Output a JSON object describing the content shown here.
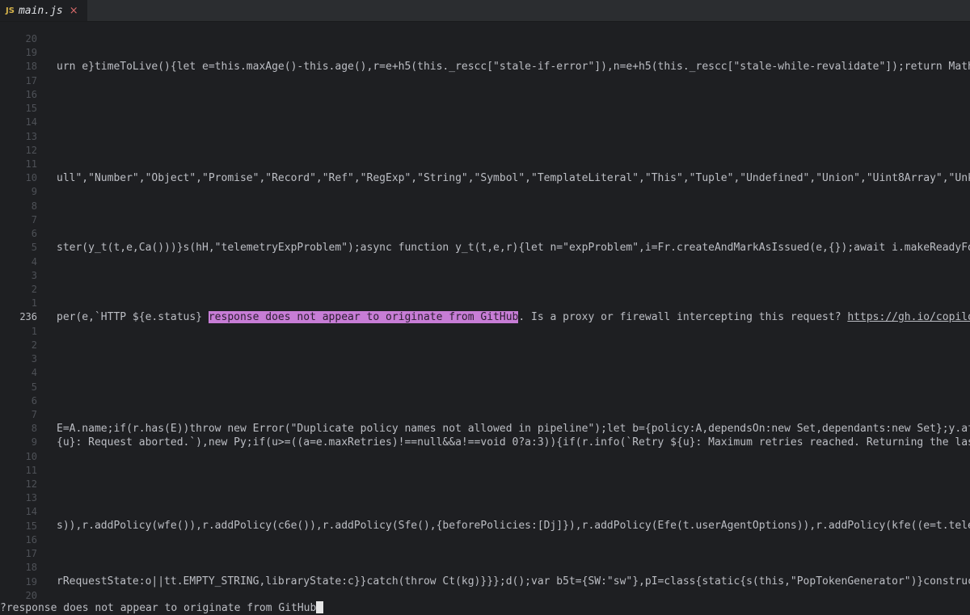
{
  "tab": {
    "icon": "JS",
    "filename": "main.js",
    "close": "×"
  },
  "gutter": [
    "20",
    "19",
    "18",
    "17",
    "16",
    "15",
    "14",
    "13",
    "12",
    "11",
    "10",
    "9",
    "8",
    "7",
    "6",
    "5",
    "4",
    "3",
    "2",
    "1",
    "236",
    "1",
    "2",
    "3",
    "4",
    "5",
    "6",
    "7",
    "8",
    "9",
    "10",
    "11",
    "12",
    "13",
    "14",
    "15",
    "16",
    "17",
    "18",
    "19",
    "20"
  ],
  "current_line_index": 20,
  "lines": {
    "l18": "urn e}timeToLive(){let e=this.maxAge()-this.age(),r=e+h5(this._rescc[\"stale-if-error\"]),n=e+h5(this._rescc[\"stale-while-revalidate\"]);return Math.",
    "l10": "ull\",\"Number\",\"Object\",\"Promise\",\"Record\",\"Ref\",\"RegExp\",\"String\",\"Symbol\",\"TemplateLiteral\",\"This\",\"Tuple\",\"Undefined\",\"Union\",\"Uint8Array\",\"Unkn",
    "l5": "ster(y_t(t,e,Ca()))}s(hH,\"telemetryExpProblem\");async function y_t(t,e,r){let n=\"expProblem\",i=Fr.createAndMarkAsIssued(e,{});await i.makeReadyFor",
    "l236_pre": "per(e,`HTTP ${e.status} ",
    "l236_match": "response does not appear to originate from GitHub",
    "l236_post": ". Is a proxy or firewall intercepting this request? ",
    "l236_link": "https://gh.io/copilot",
    "l8": "E=A.name;if(r.has(E))throw new Error(\"Duplicate policy names not allowed in pipeline\");let b={policy:A,dependsOn:new Set,dependants:new Set};y.aft",
    "l9": "{u}: Request aborted.`),new Py;if(u>=((a=e.maxRetries)!==null&&a!==void 0?a:3)){if(r.info(`Retry ${u}: Maximum retries reached. Returning the last",
    "l15": "s)),r.addPolicy(wfe()),r.addPolicy(c6e()),r.addPolicy(Sfe(),{beforePolicies:[Dj]}),r.addPolicy(Efe(t.userAgentOptions)),r.addPolicy(kfe((e=t.tele",
    "l19": "rRequestState:o||tt.EMPTY_STRING,libraryState:c}}catch(throw Ct(kg)}}};d();var b5t={SW:\"sw\"},pI=class{static{s(this,\"PopTokenGenerator\")}construct"
  },
  "search": {
    "prefix": "?",
    "query": "response does not appear to originate from GitHub"
  }
}
